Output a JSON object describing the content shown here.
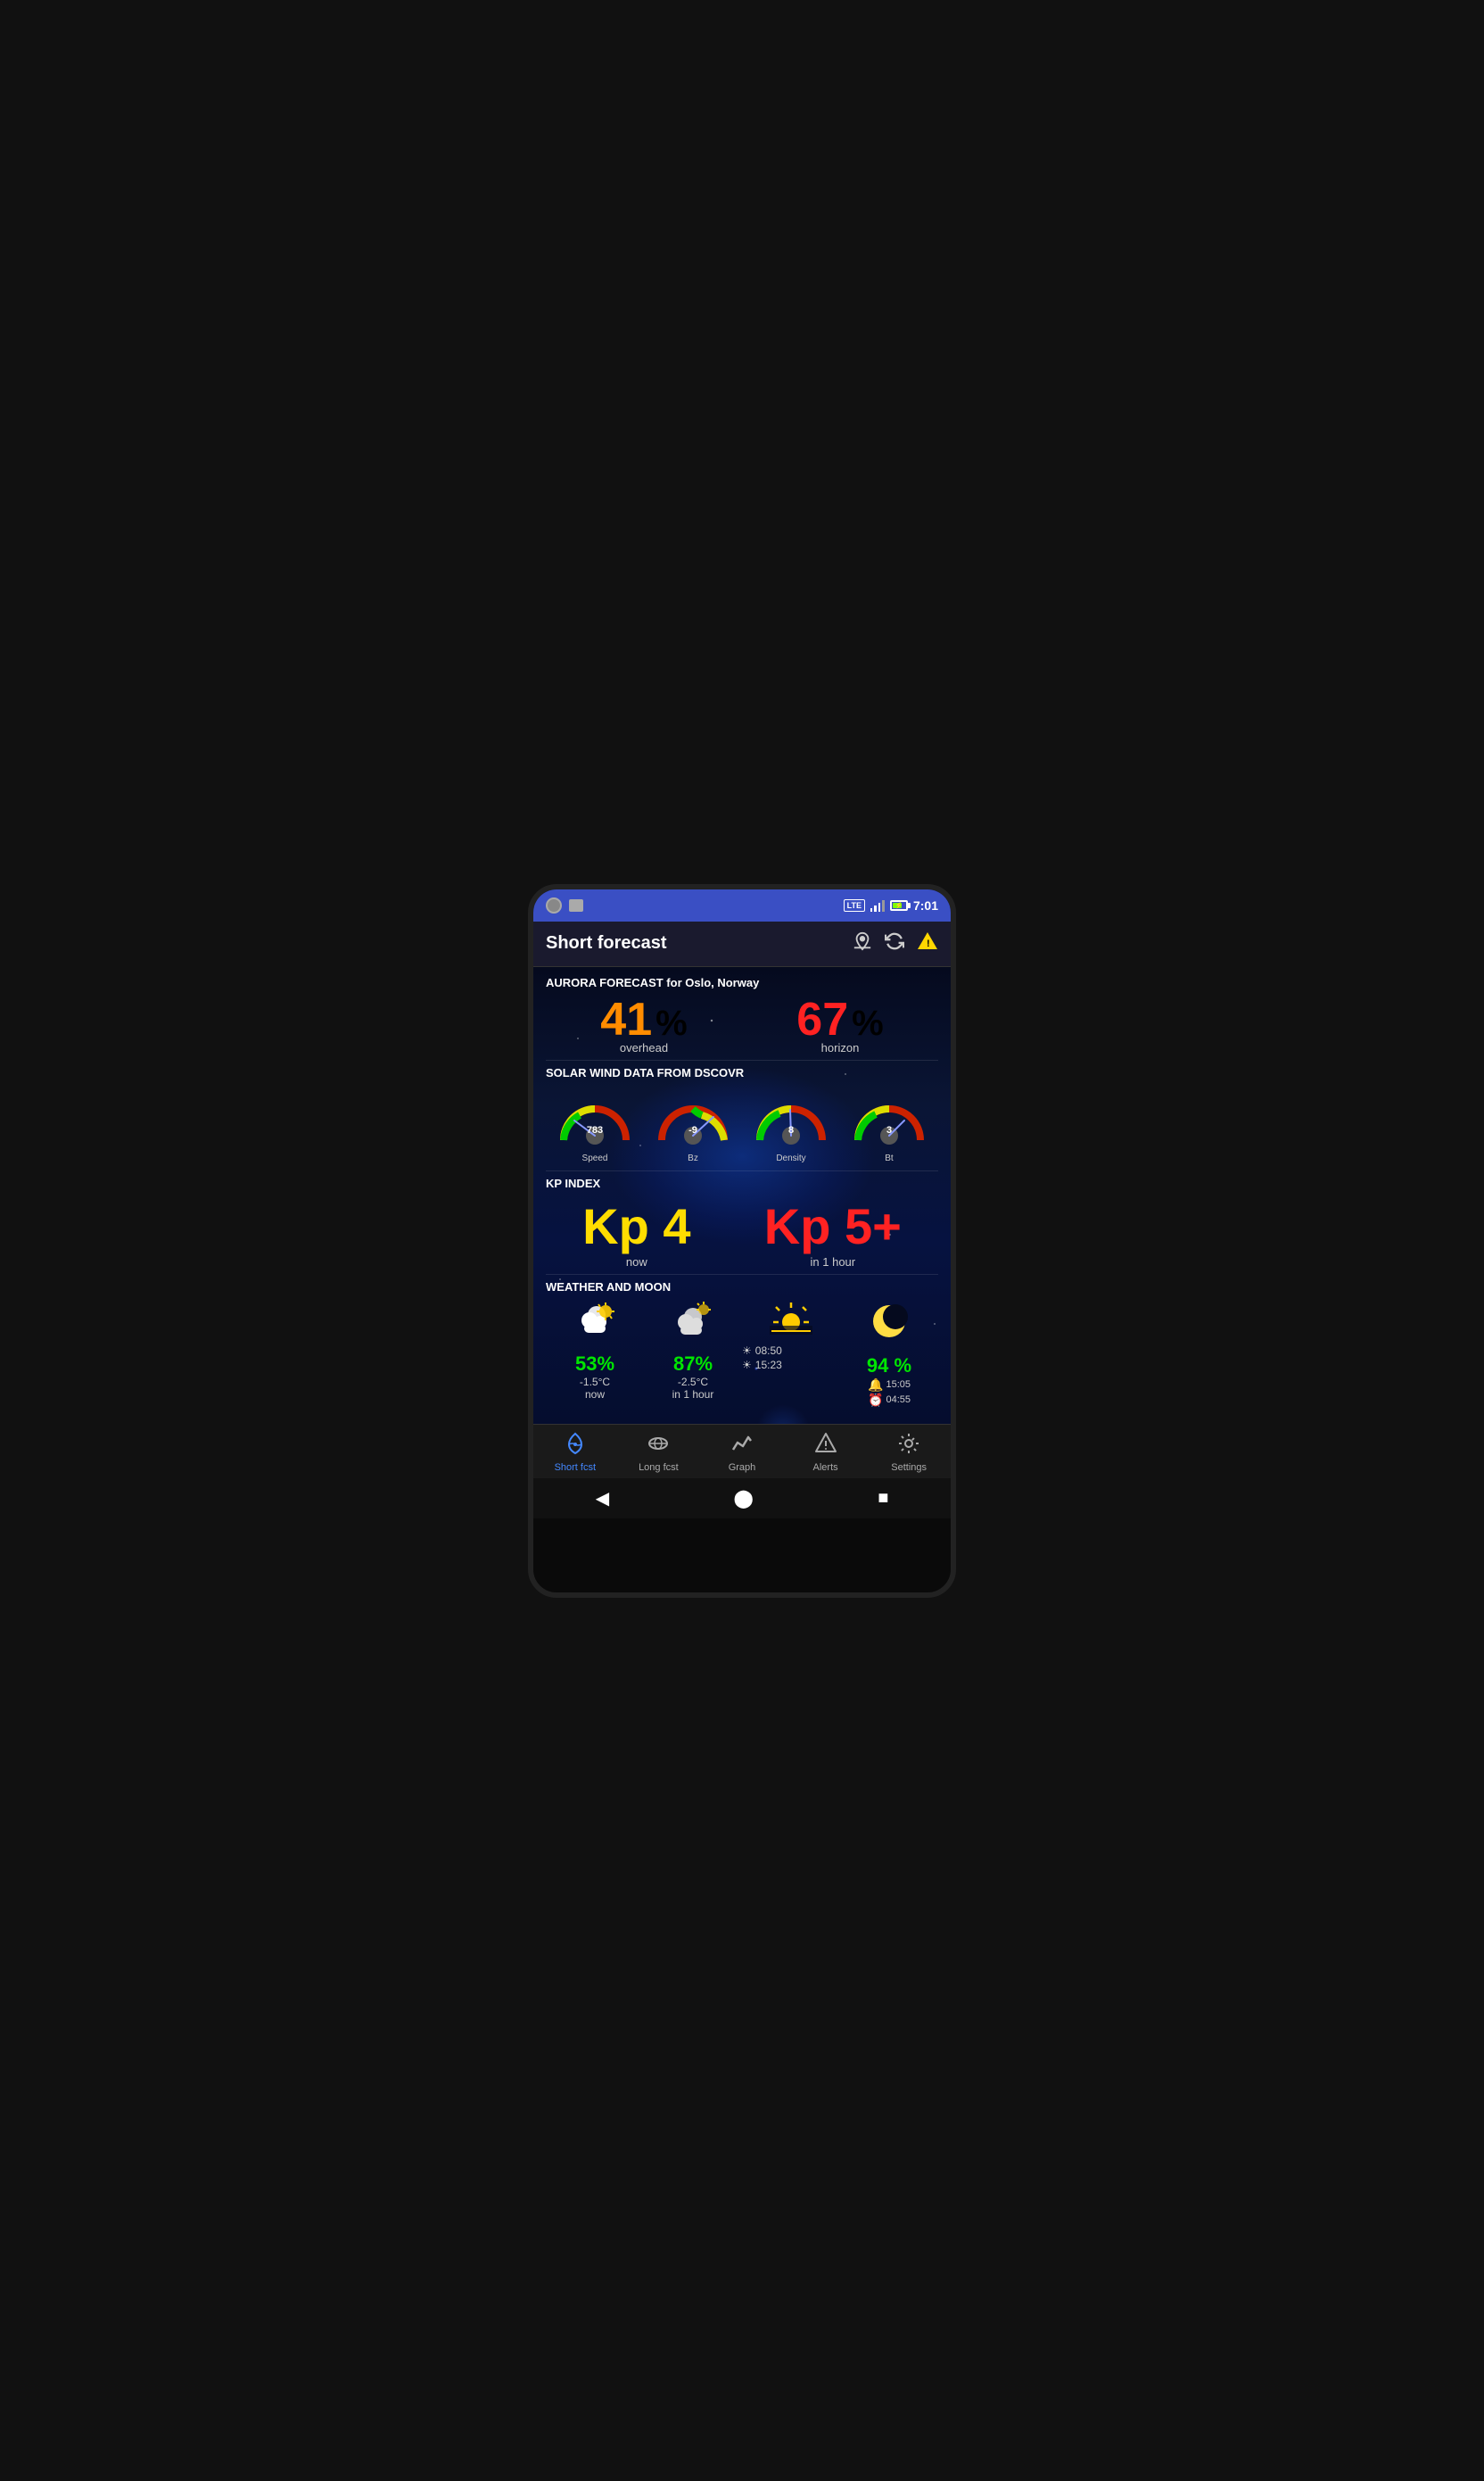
{
  "statusBar": {
    "time": "7:01",
    "lte": "LTE"
  },
  "topBar": {
    "title": "Short forecast",
    "locationIcon": "📍",
    "refreshIcon": "🔄",
    "warningIcon": "⚠"
  },
  "aurora": {
    "header": "AURORA FORECAST for Oslo, Norway",
    "overhead": {
      "value": "41",
      "symbol": "%",
      "label": "overhead"
    },
    "horizon": {
      "value": "67",
      "symbol": "%",
      "label": "horizon"
    }
  },
  "solarWind": {
    "title": "SOLAR WIND DATA FROM DSCOVR",
    "gauges": [
      {
        "value": "783",
        "label": "Speed"
      },
      {
        "value": "-9",
        "label": "Bz"
      },
      {
        "value": "8",
        "label": "Density"
      },
      {
        "value": "3",
        "label": "Bt"
      }
    ]
  },
  "kpIndex": {
    "title": "KP INDEX",
    "now": {
      "value": "Kp 4",
      "label": "now"
    },
    "forecast": {
      "value": "Kp 5+",
      "label": "in 1 hour"
    }
  },
  "weather": {
    "title": "WEATHER AND MOON",
    "items": [
      {
        "icon": "⛅",
        "pct": "53%",
        "temp": "-1.5°C",
        "label": "now"
      },
      {
        "icon": "🌥",
        "pct": "87%",
        "temp": "-2.5°C",
        "label": "in 1 hour"
      }
    ],
    "sunrise": {
      "rise": "08:50",
      "set": "15:23"
    },
    "moon": {
      "pct": "94 %",
      "alarm1": "15:05",
      "alarm2": "04:55"
    }
  },
  "bottomNav": [
    {
      "icon": "📡",
      "label": "Short fcst",
      "active": true
    },
    {
      "icon": "🌐",
      "label": "Long fcst",
      "active": false
    },
    {
      "icon": "📈",
      "label": "Graph",
      "active": false
    },
    {
      "icon": "🔔",
      "label": "Alerts",
      "active": false
    },
    {
      "icon": "⚙",
      "label": "Settings",
      "active": false
    }
  ],
  "androidNav": {
    "back": "◀",
    "home": "⬤",
    "recent": "■"
  }
}
